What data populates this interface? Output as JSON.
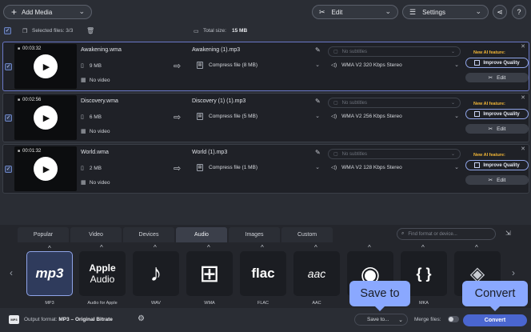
{
  "toolbar": {
    "add_media": "Add Media",
    "edit": "Edit",
    "settings": "Settings"
  },
  "selection": {
    "selected_label": "Selected files: 3/3",
    "total_size": "Total size:",
    "total_size_value": "15 MB"
  },
  "files": [
    {
      "duration": "00:03:32",
      "name": "Awakening.wma",
      "size": "9 MB",
      "video": "No video",
      "output_name": "Awakening (1).mp3",
      "compress": "Compress file (8 MB)",
      "subtitles": "No subtitles",
      "audio": "WMA V2 320 Kbps Stereo",
      "ai_label": "New AI feature:",
      "improve": "Improve Quality",
      "edit": "Edit"
    },
    {
      "duration": "00:02:56",
      "name": "Discovery.wma",
      "size": "6 MB",
      "video": "No video",
      "output_name": "Discovery (1) (1).mp3",
      "compress": "Compress file (5 MB)",
      "subtitles": "No subtitles",
      "audio": "WMA V2 256 Kbps Stereo",
      "ai_label": "New AI feature:",
      "improve": "Improve Quality",
      "edit": "Edit"
    },
    {
      "duration": "00:01:32",
      "name": "World.wma",
      "size": "2 MB",
      "video": "No video",
      "output_name": "World (1).mp3",
      "compress": "Compress file (1 MB)",
      "subtitles": "No subtitles",
      "audio": "WMA V2 128 Kbps Stereo",
      "ai_label": "New AI feature:",
      "improve": "Improve Quality",
      "edit": "Edit"
    }
  ],
  "format_panel": {
    "tabs": [
      "Popular",
      "Video",
      "Devices",
      "Audio",
      "Images",
      "Custom"
    ],
    "active_tab": "Audio",
    "search_placeholder": "Find format or device...",
    "formats": [
      {
        "label": "MP3",
        "icon_text": "mp3"
      },
      {
        "label": "Audio for Apple",
        "icon_text": "Apple",
        "icon_sub": "Audio"
      },
      {
        "label": "WAV",
        "icon_text": "♪"
      },
      {
        "label": "WMA",
        "icon_text": "⊞"
      },
      {
        "label": "FLAC",
        "icon_text": "flac"
      },
      {
        "label": "AAC",
        "icon_text": "aac"
      },
      {
        "label": "",
        "icon_text": "◉"
      },
      {
        "label": "MKA",
        "icon_text": "{ }"
      },
      {
        "label": "",
        "icon_text": "◈"
      }
    ]
  },
  "bottom": {
    "output_format_label": "Output format:",
    "output_format_value": "MP3 – Original Bitrate",
    "format_badge": "MP3",
    "save_to": "Save to...",
    "merge_files": "Merge files:",
    "convert": "Convert"
  },
  "callouts": {
    "save_to": "Save to",
    "convert": "Convert"
  },
  "colors": {
    "accent": "#4a66d0",
    "callout": "#8aa8ff",
    "ai_feature": "#f2b636"
  }
}
